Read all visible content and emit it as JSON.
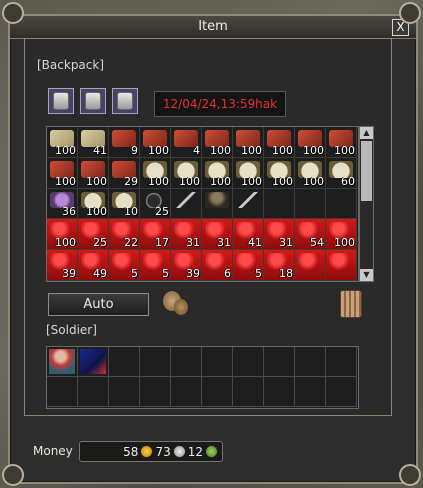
{
  "window": {
    "title": "Item",
    "close_label": "X"
  },
  "backpack": {
    "label": "[Backpack]",
    "timer": "12/04/24,13:59hak",
    "cash_slots": [
      "cash-bag",
      "cash-bag",
      "cash-bag"
    ],
    "slots": [
      {
        "icon": "bag",
        "qty": "100"
      },
      {
        "icon": "bag",
        "qty": "41"
      },
      {
        "icon": "meat",
        "qty": "9"
      },
      {
        "icon": "meat",
        "qty": "100"
      },
      {
        "icon": "meat",
        "qty": "4"
      },
      {
        "icon": "meat",
        "qty": "100"
      },
      {
        "icon": "meat",
        "qty": "100"
      },
      {
        "icon": "meat",
        "qty": "100"
      },
      {
        "icon": "meat",
        "qty": "100"
      },
      {
        "icon": "meat",
        "qty": "100"
      },
      {
        "icon": "meat",
        "qty": "100"
      },
      {
        "icon": "meat",
        "qty": "100"
      },
      {
        "icon": "meat",
        "qty": "29"
      },
      {
        "icon": "bowl",
        "qty": "100"
      },
      {
        "icon": "bowl",
        "qty": "100"
      },
      {
        "icon": "bowl",
        "qty": "100"
      },
      {
        "icon": "bowl",
        "qty": "100"
      },
      {
        "icon": "bowl",
        "qty": "100"
      },
      {
        "icon": "bowl",
        "qty": "100"
      },
      {
        "icon": "bowl",
        "qty": "60"
      },
      {
        "icon": "purple",
        "qty": "36"
      },
      {
        "icon": "bowl",
        "qty": "100"
      },
      {
        "icon": "bowl",
        "qty": "10"
      },
      {
        "icon": "pan",
        "qty": "25"
      },
      {
        "icon": "sword",
        "qty": ""
      },
      {
        "icon": "knight",
        "qty": ""
      },
      {
        "icon": "sword",
        "qty": ""
      },
      {
        "icon": "",
        "qty": ""
      },
      {
        "icon": "",
        "qty": ""
      },
      {
        "icon": "",
        "qty": ""
      },
      {
        "icon": "red",
        "qty": "100"
      },
      {
        "icon": "red",
        "qty": "25"
      },
      {
        "icon": "red",
        "qty": "22"
      },
      {
        "icon": "red",
        "qty": "17"
      },
      {
        "icon": "red",
        "qty": "31"
      },
      {
        "icon": "red",
        "qty": "31"
      },
      {
        "icon": "red",
        "qty": "41"
      },
      {
        "icon": "red",
        "qty": "31"
      },
      {
        "icon": "red",
        "qty": "54"
      },
      {
        "icon": "red",
        "qty": "100"
      },
      {
        "icon": "red",
        "qty": "39"
      },
      {
        "icon": "red",
        "qty": "49"
      },
      {
        "icon": "red",
        "qty": "5"
      },
      {
        "icon": "red",
        "qty": "5"
      },
      {
        "icon": "red",
        "qty": "39"
      },
      {
        "icon": "red",
        "qty": "6"
      },
      {
        "icon": "red",
        "qty": "5"
      },
      {
        "icon": "red",
        "qty": "18"
      },
      {
        "icon": "red",
        "qty": ""
      },
      {
        "icon": "red",
        "qty": ""
      }
    ],
    "auto_label": "Auto"
  },
  "soldier": {
    "label": "[Soldier]",
    "slots": [
      "soldier-female",
      "soldier-knight",
      "",
      "",
      "",
      "",
      "",
      "",
      "",
      "",
      "",
      "",
      "",
      "",
      "",
      "",
      "",
      "",
      "",
      ""
    ]
  },
  "money": {
    "label": "Money",
    "gold": "58",
    "silver": "73",
    "copper": "12"
  }
}
